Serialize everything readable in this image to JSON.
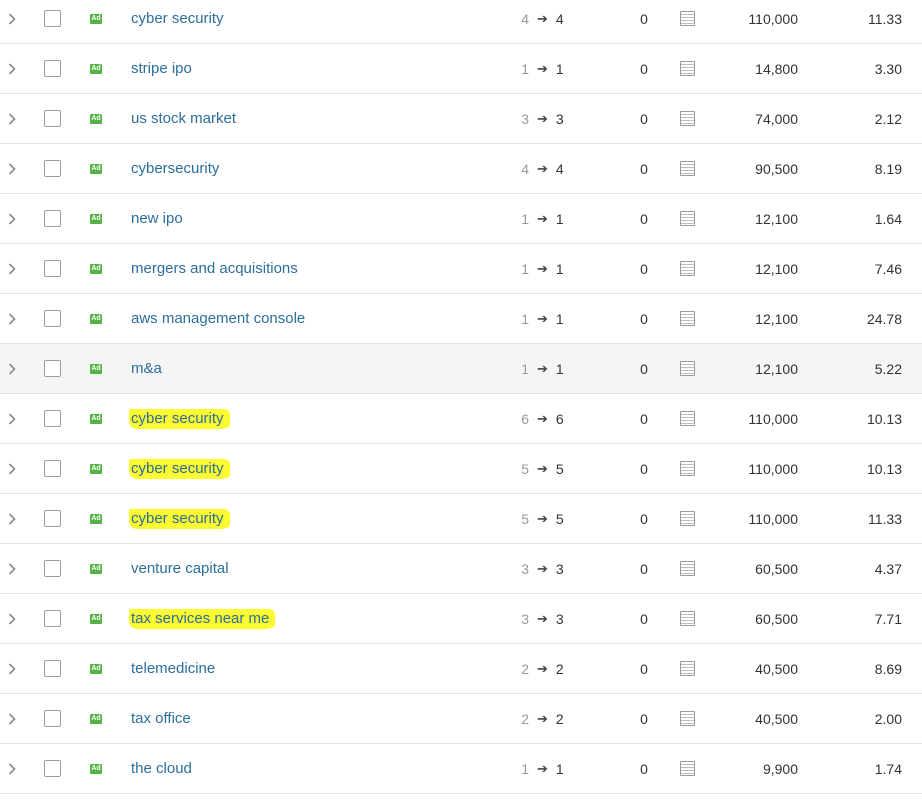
{
  "colors": {
    "link": "#2c6e9c",
    "ad_badge": "#56b346",
    "highlight": "#fbfb2f"
  },
  "icons": {
    "expand": "chevron-right-icon",
    "checkbox": "checkbox-icon",
    "ad": "ad-badge-icon",
    "serp": "serp-snapshot-icon"
  },
  "ad_badge_text": "Ad",
  "rows": [
    {
      "keyword": "cyber security",
      "pos_from": "4",
      "pos_to": "4",
      "diff": "0",
      "volume": "110,000",
      "kd": "11.33",
      "highlighted": false,
      "hover": false
    },
    {
      "keyword": "stripe ipo",
      "pos_from": "1",
      "pos_to": "1",
      "diff": "0",
      "volume": "14,800",
      "kd": "3.30",
      "highlighted": false,
      "hover": false
    },
    {
      "keyword": "us stock market",
      "pos_from": "3",
      "pos_to": "3",
      "diff": "0",
      "volume": "74,000",
      "kd": "2.12",
      "highlighted": false,
      "hover": false
    },
    {
      "keyword": "cybersecurity",
      "pos_from": "4",
      "pos_to": "4",
      "diff": "0",
      "volume": "90,500",
      "kd": "8.19",
      "highlighted": false,
      "hover": false
    },
    {
      "keyword": "new ipo",
      "pos_from": "1",
      "pos_to": "1",
      "diff": "0",
      "volume": "12,100",
      "kd": "1.64",
      "highlighted": false,
      "hover": false
    },
    {
      "keyword": "mergers and acquisitions",
      "pos_from": "1",
      "pos_to": "1",
      "diff": "0",
      "volume": "12,100",
      "kd": "7.46",
      "highlighted": false,
      "hover": false
    },
    {
      "keyword": "aws management console",
      "pos_from": "1",
      "pos_to": "1",
      "diff": "0",
      "volume": "12,100",
      "kd": "24.78",
      "highlighted": false,
      "hover": false
    },
    {
      "keyword": "m&a",
      "pos_from": "1",
      "pos_to": "1",
      "diff": "0",
      "volume": "12,100",
      "kd": "5.22",
      "highlighted": false,
      "hover": true
    },
    {
      "keyword": "cyber security",
      "pos_from": "6",
      "pos_to": "6",
      "diff": "0",
      "volume": "110,000",
      "kd": "10.13",
      "highlighted": true,
      "hover": false
    },
    {
      "keyword": "cyber security",
      "pos_from": "5",
      "pos_to": "5",
      "diff": "0",
      "volume": "110,000",
      "kd": "10.13",
      "highlighted": true,
      "hover": false
    },
    {
      "keyword": "cyber security",
      "pos_from": "5",
      "pos_to": "5",
      "diff": "0",
      "volume": "110,000",
      "kd": "11.33",
      "highlighted": true,
      "hover": false
    },
    {
      "keyword": "venture capital",
      "pos_from": "3",
      "pos_to": "3",
      "diff": "0",
      "volume": "60,500",
      "kd": "4.37",
      "highlighted": false,
      "hover": false
    },
    {
      "keyword": "tax services near me",
      "pos_from": "3",
      "pos_to": "3",
      "diff": "0",
      "volume": "60,500",
      "kd": "7.71",
      "highlighted": true,
      "hover": false
    },
    {
      "keyword": "telemedicine",
      "pos_from": "2",
      "pos_to": "2",
      "diff": "0",
      "volume": "40,500",
      "kd": "8.69",
      "highlighted": false,
      "hover": false
    },
    {
      "keyword": "tax office",
      "pos_from": "2",
      "pos_to": "2",
      "diff": "0",
      "volume": "40,500",
      "kd": "2.00",
      "highlighted": false,
      "hover": false
    },
    {
      "keyword": "the cloud",
      "pos_from": "1",
      "pos_to": "1",
      "diff": "0",
      "volume": "9,900",
      "kd": "1.74",
      "highlighted": false,
      "hover": false
    }
  ]
}
